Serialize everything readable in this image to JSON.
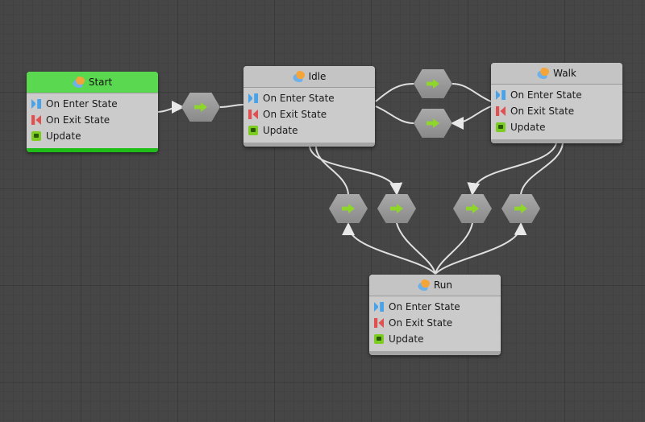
{
  "colors": {
    "start_header": "#5ad84f",
    "background": "#464646",
    "transition_arrow": "#8fd62a"
  },
  "states": [
    {
      "name": "Start",
      "rows": [
        "On Enter State",
        "On Exit State",
        "Update"
      ]
    },
    {
      "name": "Idle",
      "rows": [
        "On Enter State",
        "On Exit State",
        "Update"
      ]
    },
    {
      "name": "Walk",
      "rows": [
        "On Enter State",
        "On Exit State",
        "Update"
      ]
    },
    {
      "name": "Run",
      "rows": [
        "On Enter State",
        "On Exit State",
        "Update"
      ]
    }
  ],
  "row_icons": [
    "on-enter-icon",
    "on-exit-icon",
    "update-icon"
  ]
}
